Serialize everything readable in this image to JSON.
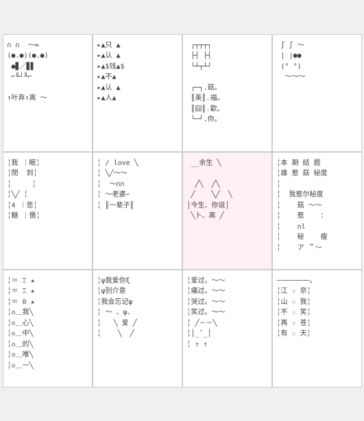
{
  "cards": [
    {
      "id": "card-1",
      "bg": "white",
      "lines": [
        "∩ ∩  ～∞",
        "(●.●)(●.●)",
        "●▊／▊▋",
        "⌐╙┘╙⌐",
        "",
        "↑叶弃↑离 ～"
      ]
    },
    {
      "id": "card-2",
      "bg": "white",
      "lines": [
        "▲只 ▲",
        "▲认 ▲",
        "▲$钱▲$",
        "▲不▲",
        "▲认 ▲",
        "▲人▲"
      ]
    },
    {
      "id": "card-3",
      "bg": "white",
      "lines": [
        "┌┬┬┬┐",
        "├┤ ├┤",
        "└┴┬┴┘",
        "",
        "┌─┐.菇。",
        "║美║.福。",
        "║囧║.歡。",
        "└─┘.你。"
      ]
    },
    {
      "id": "card-4",
      "bg": "white",
      "lines": [
        "∫ ∫ ～",
        "| |●●",
        "(° °)",
        "～～～"
      ]
    },
    {
      "id": "card-5",
      "bg": "white",
      "lines": [
        "╎我 | 眠╎",
        "╎閉  到╎",
        "╎     ╎",
        "╎╲╱╎",
        "╎4 | 悲╎",
        "╎糖 | 慑╎"
      ]
    },
    {
      "id": "card-6",
      "bg": "white",
      "lines": [
        "╎ ∕ love ╲",
        "╎╲╱～～",
        "╎ ～∩∩ ",
        "╎ ～老婆∽",
        "╎ ║一辈子║"
      ]
    },
    {
      "id": "card-7",
      "bg": "pink",
      "lines": [
        "__余生 ╲",
        "",
        " ╱╲  ╱╲",
        "╱    ╲╱    ╲",
        "│今生、你说│",
        " ╲卜、离 ╱"
      ]
    },
    {
      "id": "card-8",
      "bg": "white",
      "lines": [
        "╎本 期 结 题",
        "╎誰 惹 菇 秘度",
        "╎",
        "╎我惹尔秘度",
        "╎  菇 ～～",
        "╎  惹    ：",
        "╎  nl",
        "╎  秘    瘦",
        "╎  ア ＂～"
      ]
    },
    {
      "id": "card-9",
      "bg": "white",
      "lines": [
        "╎＝ Ξ ★",
        "╎＝ Ξ ★",
        "╎＝ 0 ★",
        "╎◇＿我╲",
        "╎◇＿心╲",
        "╎◇＿中╲",
        "╎◇＿的╲",
        "╎◇＿唯╲",
        "╎◇＿一╲"
      ]
    },
    {
      "id": "card-10",
      "bg": "white",
      "lines": [
        "╎ψ我爱你ξ",
        "╎ψ别介意",
        "╎我会忘记ψ",
        "╎ ～ 、ψ、",
        "╎   ╲ 爱 ╱",
        "╎    ╲  ╱"
      ]
    },
    {
      "id": "card-11",
      "bg": "white",
      "lines": [
        "╎爱过。～～",
        "╎痛过。～～",
        "╎哭过。～～",
        "╎笑过。～～",
        "╎ ╱－－╲",
        "╎│_ˇ_│",
        "╎ ↑ ↑"
      ]
    },
    {
      "id": "card-12",
      "bg": "white",
      "lines": [
        "╌╌╌╌╌╌╌╌。",
        "╎江☆奈╎",
        "╎山☆我╎",
        "╎不☆笑╎",
        "╎再☆苍╎",
        "╎有☆天╎"
      ]
    }
  ]
}
